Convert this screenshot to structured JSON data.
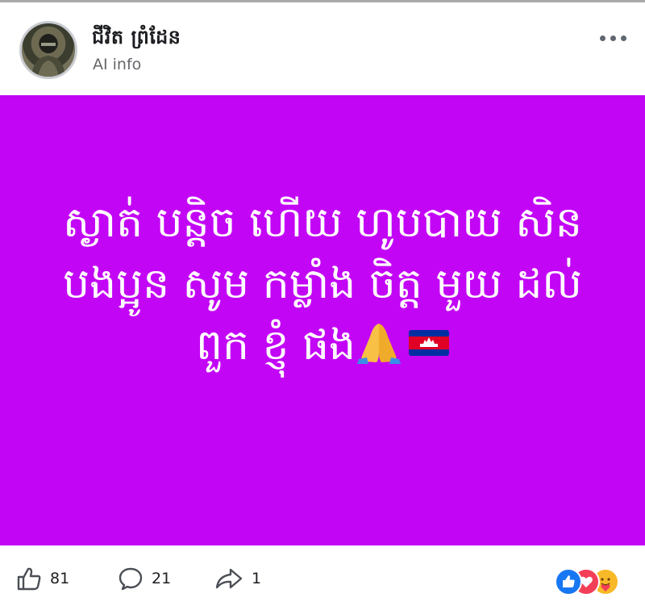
{
  "post": {
    "author_name": "ជីវិត ព្រំដែន",
    "author_subtitle": "AI info",
    "lines": [
      "ស្ងាត់ បន្តិច ហើយ ហូបបាយ សិន",
      "បងប្អូន សូម កម្លាំង ចិត្ត មួយ ដល់",
      "ពួក ខ្ញុំ ផង"
    ],
    "emojis": [
      "folded-hands",
      "cambodia-flag"
    ],
    "background_color": "#c305f6"
  },
  "footer": {
    "like_count": "81",
    "comment_count": "21",
    "share_count": "1",
    "reactions": [
      "like",
      "love",
      "care"
    ]
  },
  "menu": {
    "icon": "more-options-icon"
  }
}
